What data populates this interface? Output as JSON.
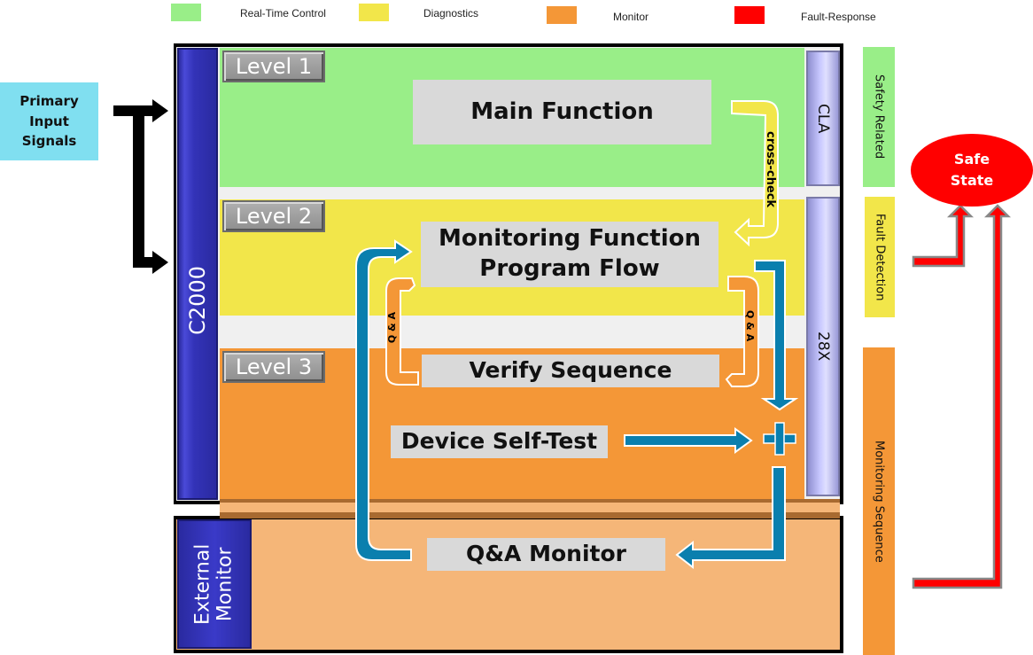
{
  "legend": [
    {
      "label": "Real-Time Control",
      "color": "#99ee88"
    },
    {
      "label": "Diagnostics",
      "color": "#f2e64a"
    },
    {
      "label": "Monitor",
      "color": "#f49737"
    },
    {
      "label": "Fault-Response",
      "color": "#ff0000"
    }
  ],
  "input": {
    "label": "Primary Input Signals",
    "line1": "Primary",
    "line2": "Input",
    "line3": "Signals",
    "color": "#80dff0"
  },
  "device": {
    "label": "C2000",
    "color": "#3333b8"
  },
  "external": {
    "line1": "External",
    "line2": "Monitor"
  },
  "levels": [
    {
      "label": "Level 1",
      "color": "#99ee88"
    },
    {
      "label": "Level 2",
      "color": "#f2e64a"
    },
    {
      "label": "Level 3",
      "color": "#f49737"
    }
  ],
  "boxes": {
    "main_function": "Main Function",
    "monitoring_line1": "Monitoring Function",
    "monitoring_line2": "Program Flow",
    "verify_sequence": "Verify Sequence",
    "device_self_test": "Device Self-Test",
    "qa_monitor": "Q&A Monitor"
  },
  "cores": {
    "cla": "CLA",
    "c28x": "28X"
  },
  "arrows": {
    "cross_check": "cross-check",
    "qa_left": "Q & A",
    "qa_right": "Q & A",
    "plus": "+"
  },
  "side_labels": {
    "safety_related": "Safety Related",
    "fault_detection": "Fault Detection",
    "monitoring_sequence": "Monitoring Sequence"
  },
  "safe_state": {
    "line1": "Safe",
    "line2": "State",
    "color": "#ff0000"
  },
  "colors": {
    "flow_blue": "#0a7fae",
    "ext_orange": "#f5b678",
    "sep": "#f0f0f0"
  }
}
